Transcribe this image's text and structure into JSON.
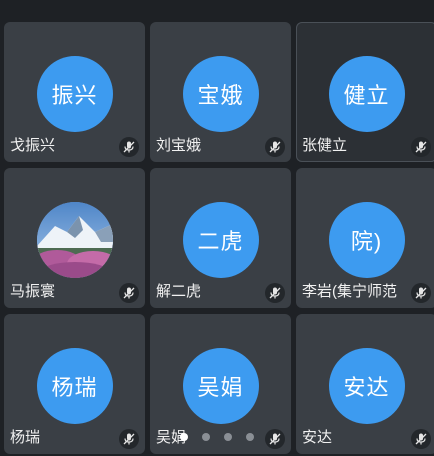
{
  "participants": [
    {
      "avatar_text": "振兴",
      "name": "戈振兴",
      "mic": "mic-muted-icon"
    },
    {
      "avatar_text": "宝娥",
      "name": "刘宝娥",
      "mic": "mic-muted-icon"
    },
    {
      "avatar_text": "健立",
      "name": "张健立",
      "mic": "mic-muted-icon"
    },
    {
      "avatar_text": "",
      "name": "马振寰",
      "mic": "mic-muted-icon",
      "avatar_type": "photo"
    },
    {
      "avatar_text": "二虎",
      "name": "解二虎",
      "mic": "mic-muted-icon"
    },
    {
      "avatar_text": "院)",
      "name": "李岩(集宁师范",
      "mic": "mic-muted-icon"
    },
    {
      "avatar_text": "杨瑞",
      "name": "杨瑞",
      "mic": "mic-muted-icon"
    },
    {
      "avatar_text": "吴娟",
      "name": "吴娟",
      "mic": "mic-muted-icon"
    },
    {
      "avatar_text": "安达",
      "name": "安达",
      "mic": "mic-muted-icon"
    }
  ],
  "pager": {
    "total": 4,
    "current": 1
  },
  "colors": {
    "avatar_blue": "#3d9bf0",
    "tile_bg": "#3a3f45",
    "page_bg": "#1e2125"
  }
}
